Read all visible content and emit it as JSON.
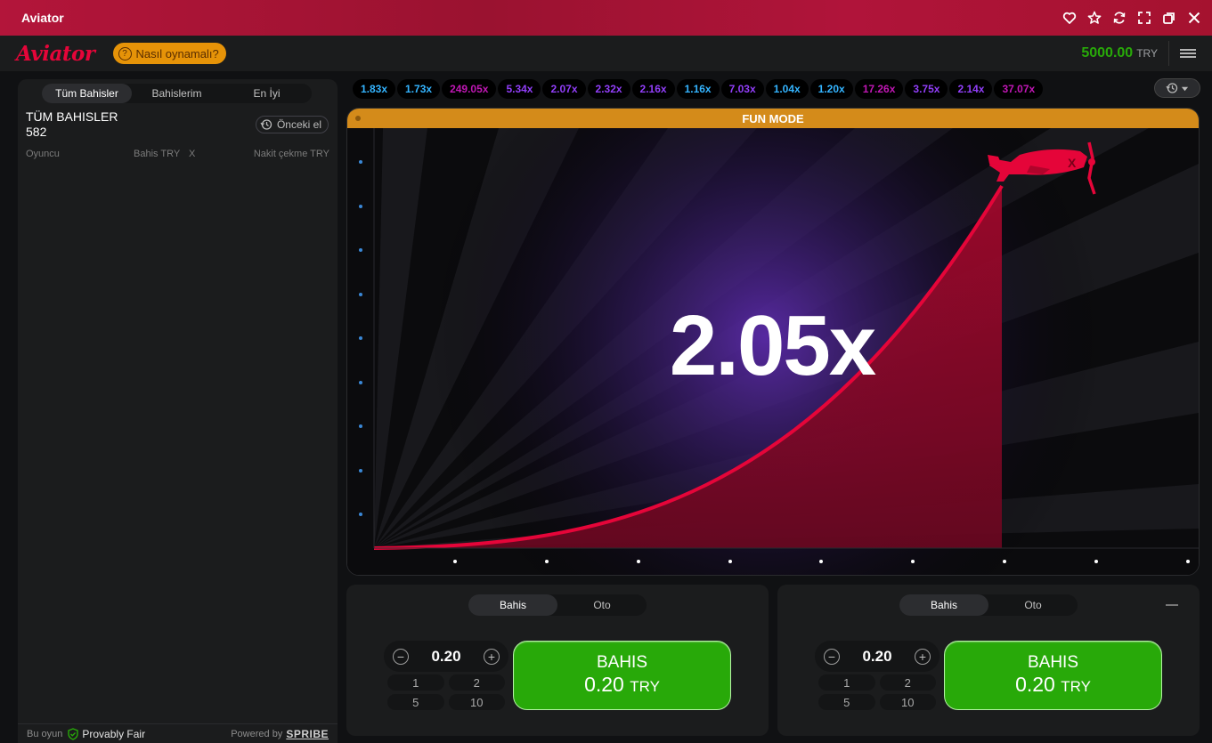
{
  "window": {
    "title": "Aviator",
    "icons": [
      "heart-icon",
      "star-icon",
      "refresh-icon",
      "fullscreen-icon",
      "restore-icon",
      "close-icon"
    ]
  },
  "header": {
    "logo": "Aviator",
    "how_to_play": "Nasıl oynamalı?",
    "balance": "5000.00",
    "currency": "TRY"
  },
  "left_panel": {
    "tabs": [
      {
        "label": "Tüm Bahisler",
        "active": true
      },
      {
        "label": "Bahislerim",
        "active": false
      },
      {
        "label": "En İyi",
        "active": false
      }
    ],
    "all_bets_title": "TÜM BAHISLER",
    "all_bets_count": "582",
    "previous_round": "Önceki el",
    "columns": {
      "player": "Oyuncu",
      "bet": "Bahis TRY",
      "x": "X",
      "cashout": "Nakit çekme TRY"
    },
    "footer": {
      "this_game": "Bu oyun",
      "provably_fair": "Provably Fair",
      "powered_by": "Powered by",
      "brand": "SPRIBE"
    }
  },
  "history": [
    {
      "value": "1.83x",
      "color": "#34b4ff"
    },
    {
      "value": "1.73x",
      "color": "#34b4ff"
    },
    {
      "value": "249.05x",
      "color": "#c017b4"
    },
    {
      "value": "5.34x",
      "color": "#913ef8"
    },
    {
      "value": "2.07x",
      "color": "#913ef8"
    },
    {
      "value": "2.32x",
      "color": "#913ef8"
    },
    {
      "value": "2.16x",
      "color": "#913ef8"
    },
    {
      "value": "1.16x",
      "color": "#34b4ff"
    },
    {
      "value": "7.03x",
      "color": "#913ef8"
    },
    {
      "value": "1.04x",
      "color": "#34b4ff"
    },
    {
      "value": "1.20x",
      "color": "#34b4ff"
    },
    {
      "value": "17.26x",
      "color": "#c017b4"
    },
    {
      "value": "3.75x",
      "color": "#913ef8"
    },
    {
      "value": "2.14x",
      "color": "#913ef8"
    },
    {
      "value": "37.07x",
      "color": "#c017b4"
    }
  ],
  "game": {
    "mode_label": "FUN MODE",
    "multiplier": "2.05x",
    "accent_color": "#e50539"
  },
  "bet_panels": [
    {
      "tabs": [
        {
          "label": "Bahis",
          "active": true
        },
        {
          "label": "Oto",
          "active": false
        }
      ],
      "amount": "0.20",
      "quick": [
        "1",
        "2",
        "5",
        "10"
      ],
      "button_label": "BAHIS",
      "button_amount": "0.20",
      "button_currency": "TRY"
    },
    {
      "tabs": [
        {
          "label": "Bahis",
          "active": true
        },
        {
          "label": "Oto",
          "active": false
        }
      ],
      "amount": "0.20",
      "quick": [
        "1",
        "2",
        "5",
        "10"
      ],
      "button_label": "BAHIS",
      "button_amount": "0.20",
      "button_currency": "TRY"
    }
  ]
}
